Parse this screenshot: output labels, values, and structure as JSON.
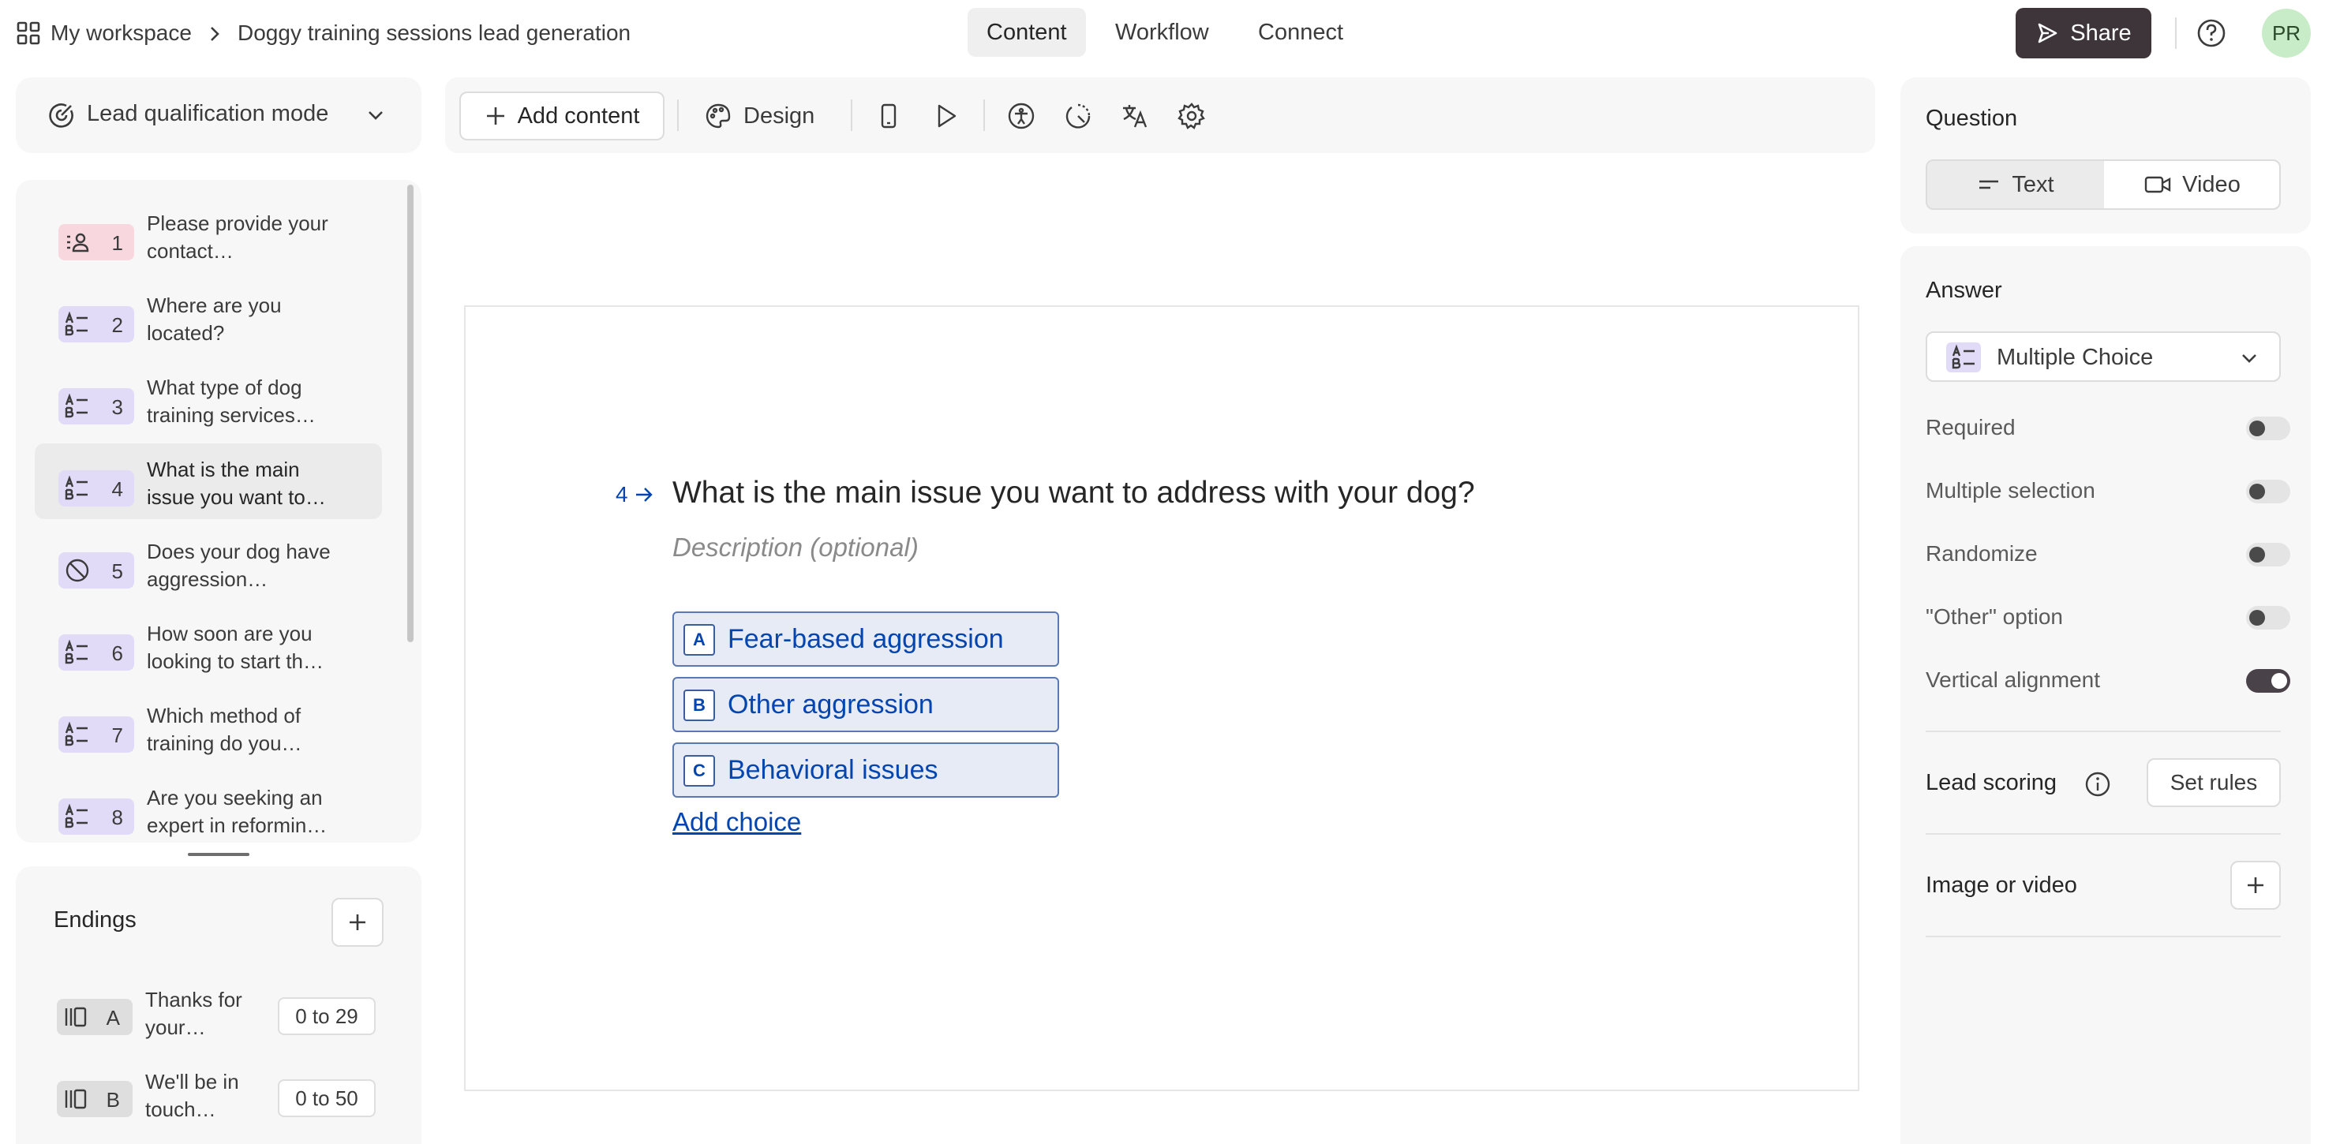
{
  "topbar": {
    "workspace": "My workspace",
    "form_title": "Doggy training sessions lead generation",
    "tabs": [
      "Content",
      "Workflow",
      "Connect"
    ],
    "share_label": "Share",
    "avatar_initials": "PR"
  },
  "mode": {
    "label": "Lead qualification mode"
  },
  "questions": [
    {
      "num": "1",
      "text": "Please provide your contact…",
      "icon": "contact-icon"
    },
    {
      "num": "2",
      "text": "Where are you located?",
      "icon": "multiple-choice-icon"
    },
    {
      "num": "3",
      "text": "What type of dog training services…",
      "icon": "multiple-choice-icon"
    },
    {
      "num": "4",
      "text": "What is the main issue you want to…",
      "icon": "multiple-choice-icon"
    },
    {
      "num": "5",
      "text": "Does your dog have aggression…",
      "icon": "yes-no-icon"
    },
    {
      "num": "6",
      "text": "How soon are you looking to start th…",
      "icon": "multiple-choice-icon"
    },
    {
      "num": "7",
      "text": "Which method of training do you…",
      "icon": "multiple-choice-icon"
    },
    {
      "num": "8",
      "text": "Are you seeking an expert in reformin…",
      "icon": "multiple-choice-icon"
    }
  ],
  "endings": {
    "title": "Endings",
    "items": [
      {
        "key": "A",
        "text": "Thanks for your…",
        "range": "0 to 29"
      },
      {
        "key": "B",
        "text": "We'll be in touch…",
        "range": "0 to 50"
      }
    ]
  },
  "toolbar": {
    "add_content": "Add content",
    "design": "Design"
  },
  "canvas": {
    "number": "4",
    "title": "What is the main issue you want to address with your dog?",
    "description_placeholder": "Description (optional)",
    "choices": [
      {
        "key": "A",
        "label": "Fear-based aggression"
      },
      {
        "key": "B",
        "label": "Other aggression"
      },
      {
        "key": "C",
        "label": "Behavioral issues"
      }
    ],
    "add_choice": "Add choice"
  },
  "right": {
    "question_title": "Question",
    "type_options": [
      "Text",
      "Video"
    ],
    "answer_title": "Answer",
    "answer_type": "Multiple Choice",
    "settings": [
      {
        "label": "Required",
        "on": false
      },
      {
        "label": "Multiple selection",
        "on": false
      },
      {
        "label": "Randomize",
        "on": false
      },
      {
        "label": "\"Other\" option",
        "on": false
      },
      {
        "label": "Vertical alignment",
        "on": true
      }
    ],
    "lead_scoring": "Lead scoring",
    "set_rules": "Set rules",
    "image_or_video": "Image or video"
  },
  "colors": {
    "accent_dark": "#3d3539",
    "choice_blue": "#0445af",
    "choice_bg": "#e6ebf6",
    "mc_badge": "#e2dbf7",
    "contact_badge": "#f9d7df"
  }
}
